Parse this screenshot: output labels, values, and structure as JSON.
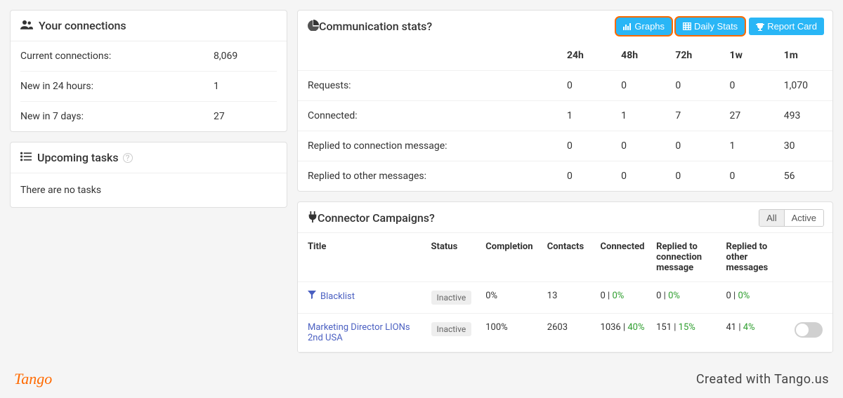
{
  "connections": {
    "title": "Your connections",
    "rows": [
      {
        "label": "Current connections:",
        "value": "8,069"
      },
      {
        "label": "New in 24 hours:",
        "value": "1"
      },
      {
        "label": "New in 7 days:",
        "value": "27"
      }
    ]
  },
  "tasks": {
    "title": "Upcoming tasks",
    "empty": "There are no tasks"
  },
  "stats": {
    "title": "Communication stats",
    "buttons": {
      "graphs": "Graphs",
      "daily": "Daily Stats",
      "report": "Report Card"
    },
    "cols": [
      "24h",
      "48h",
      "72h",
      "1w",
      "1m"
    ],
    "rows": [
      {
        "label": "Requests:",
        "vals": [
          "0",
          "0",
          "0",
          "0",
          "1,070"
        ]
      },
      {
        "label": "Connected:",
        "vals": [
          "1",
          "1",
          "7",
          "27",
          "493"
        ]
      },
      {
        "label": "Replied to connection message:",
        "vals": [
          "0",
          "0",
          "0",
          "1",
          "30"
        ]
      },
      {
        "label": "Replied to other messages:",
        "vals": [
          "0",
          "0",
          "0",
          "0",
          "56"
        ]
      }
    ]
  },
  "campaigns": {
    "title": "Connector Campaigns",
    "seg": {
      "all": "All",
      "active": "Active"
    },
    "head": {
      "title": "Title",
      "status": "Status",
      "completion": "Completion",
      "contacts": "Contacts",
      "connected": "Connected",
      "r1": "Replied to connection message",
      "r2": "Replied to other messages"
    },
    "rows": [
      {
        "name": "Blacklist",
        "icon": true,
        "status": "Inactive",
        "completion": "0%",
        "contacts": "13",
        "connected_n": "0",
        "connected_p": "0%",
        "r1_n": "0",
        "r1_p": "0%",
        "r2_n": "0",
        "r2_p": "0%",
        "toggle": false
      },
      {
        "name": "Marketing Director LIONs 2nd USA",
        "icon": false,
        "status": "Inactive",
        "completion": "100%",
        "contacts": "2603",
        "connected_n": "1036",
        "connected_p": "40%",
        "r1_n": "151",
        "r1_p": "15%",
        "r2_n": "41",
        "r2_p": "4%",
        "toggle": true
      }
    ]
  },
  "footer": {
    "logo": "Tango",
    "credit": "Created with Tango.us"
  }
}
